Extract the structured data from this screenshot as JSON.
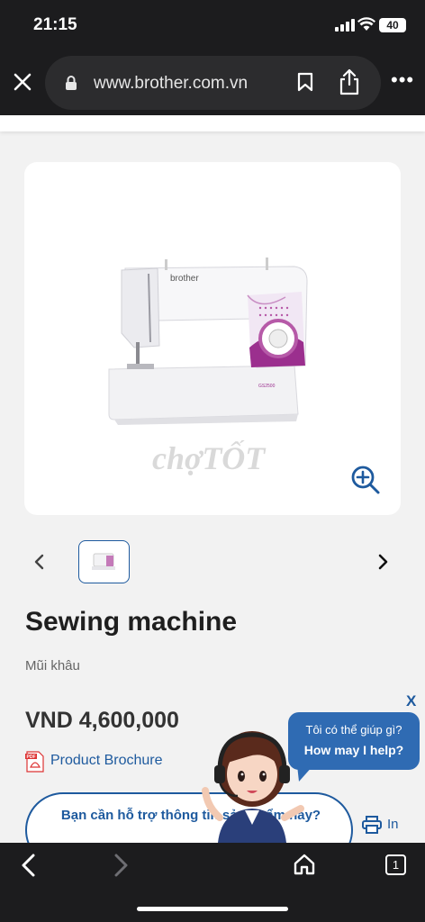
{
  "status_bar": {
    "time": "21:15",
    "battery": "40"
  },
  "browser": {
    "url": "www.brother.com.vn",
    "tab_count": "1"
  },
  "product": {
    "title": "Sewing machine",
    "subtitle": "Mũi khâu",
    "price": "VND 4,600,000",
    "brochure_label": "Product Brochure",
    "brand_on_image": "brother",
    "watermark": "chợTỐT"
  },
  "support": {
    "button_text": "Bạn cần hỗ trợ thông tin sản phẩm này?",
    "print_label": "In"
  },
  "chat": {
    "close": "X",
    "line1": "Tôi có thể giúp gì?",
    "line2": "How may I help?"
  },
  "colors": {
    "accent": "#1e5a9e",
    "bubble": "#2f6bb3",
    "chrome": "#1c1c1e"
  }
}
